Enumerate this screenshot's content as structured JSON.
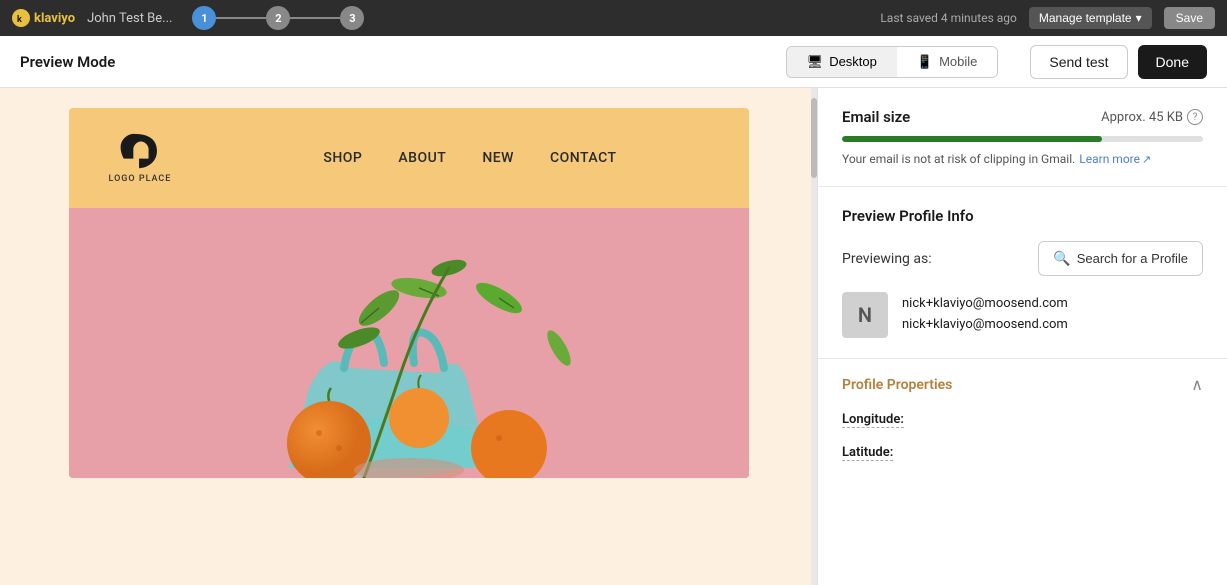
{
  "topbar": {
    "logo": "klaviyo",
    "title": "John Test Be...",
    "steps": [
      {
        "number": "1",
        "active": true
      },
      {
        "number": "2",
        "active": false
      },
      {
        "number": "3",
        "active": false
      }
    ],
    "saved_text": "Last saved 4 minutes ago",
    "manage_btn": "Manage template",
    "save_btn": "Save"
  },
  "preview_bar": {
    "label": "Preview Mode",
    "desktop_btn": "Desktop",
    "mobile_btn": "Mobile",
    "send_test_btn": "Send test",
    "done_btn": "Done"
  },
  "email_preview": {
    "nav_items": [
      "SHOP",
      "ABOUT",
      "NEW",
      "CONTACT"
    ],
    "logo_text": "LOGO PLACE"
  },
  "right_panel": {
    "email_size_label": "Email size",
    "email_size_value": "Approx. 45 KB",
    "progress_percent": 72,
    "clipping_msg": "Your email is not at risk of clipping in Gmail.",
    "learn_more": "Learn more",
    "profile_info_title": "Preview Profile Info",
    "previewing_label": "Previewing as:",
    "search_btn": "Search for a Profile",
    "avatar_letter": "N",
    "user_email_1": "nick+klaviyo@moosend.com",
    "user_email_2": "nick+klaviyo@moosend.com",
    "properties_title": "Profile Properties",
    "longitude_label": "Longitude:",
    "latitude_label": "Latitude:"
  }
}
